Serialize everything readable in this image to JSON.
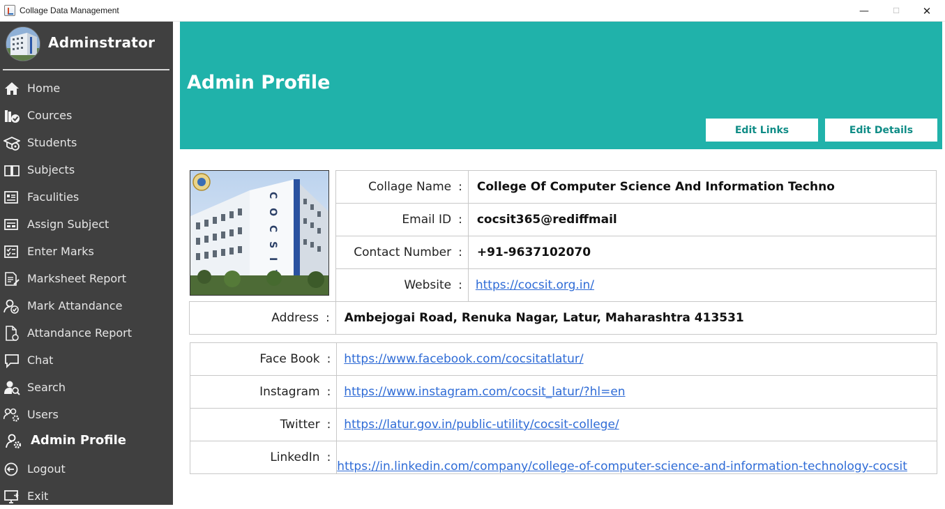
{
  "window": {
    "title": "Collage Data Management",
    "controls": {
      "minimize": "—",
      "maximize": "☐",
      "close": "✕"
    }
  },
  "sidebar": {
    "title": "Adminstrator",
    "items": [
      {
        "label": "Home",
        "icon": "home-icon"
      },
      {
        "label": "Cources",
        "icon": "books-icon"
      },
      {
        "label": "Students",
        "icon": "graduation-cap-icon"
      },
      {
        "label": "Subjects",
        "icon": "open-book-icon"
      },
      {
        "label": "Faculities",
        "icon": "id-card-icon"
      },
      {
        "label": "Assign Subject",
        "icon": "assign-icon"
      },
      {
        "label": "Enter Marks",
        "icon": "checklist-icon"
      },
      {
        "label": "Marksheet Report",
        "icon": "report-icon"
      },
      {
        "label": "Mark Attandance",
        "icon": "user-check-icon"
      },
      {
        "label": "Attandance Report",
        "icon": "document-icon"
      },
      {
        "label": "Chat",
        "icon": "chat-icon"
      },
      {
        "label": "Search",
        "icon": "user-search-icon"
      },
      {
        "label": "Users",
        "icon": "users-gear-icon"
      },
      {
        "label": "Admin Profile",
        "icon": "user-gear-icon"
      },
      {
        "label": "Logout",
        "icon": "logout-icon"
      },
      {
        "label": "Exit",
        "icon": "exit-icon"
      }
    ],
    "active_item": "Admin Profile"
  },
  "header": {
    "title": "Admin Profile",
    "edit_links": "Edit Links",
    "edit_details": "Edit Details",
    "color": "#20b2aa"
  },
  "profile": {
    "collage_name_label": "Collage Name",
    "collage_name": "College Of Computer Science And Information Techno",
    "email_label": "Email ID",
    "email": "cocsit365@rediffmail",
    "contact_label": "Contact Number",
    "contact": "+91-9637102070",
    "website_label": "Website",
    "website": "https://cocsit.org.in/",
    "address_label": "Address",
    "address": "Ambejogai Road, Renuka Nagar, Latur, Maharashtra 413531"
  },
  "social": {
    "facebook_label": "Face Book",
    "facebook": "https://www.facebook.com/cocsitatlatur/",
    "instagram_label": "Instagram",
    "instagram": "https://www.instagram.com/cocsit_latur/?hl=en",
    "twitter_label": "Twitter",
    "twitter": "https://latur.gov.in/public-utility/cocsit-college/",
    "linkedin_label": "LinkedIn",
    "linkedin": "https://in.linkedin.com/company/college-of-computer-science-and-information-technology-cocsit"
  },
  "colon": ":",
  "building_sign": "C O C S I T"
}
